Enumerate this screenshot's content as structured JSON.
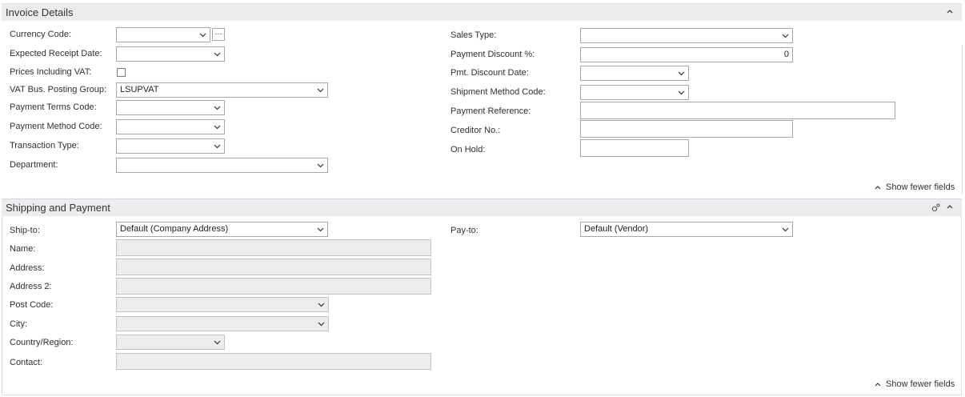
{
  "invoice": {
    "title": "Invoice Details",
    "show_fewer": "Show fewer fields",
    "left": {
      "currency_code": {
        "label": "Currency Code:",
        "value": ""
      },
      "expected_receipt_date": {
        "label": "Expected Receipt Date:",
        "value": ""
      },
      "prices_including_vat": {
        "label": "Prices Including VAT:",
        "checked": false
      },
      "vat_bus_posting_group": {
        "label": "VAT Bus. Posting Group:",
        "value": "LSUPVAT"
      },
      "payment_terms_code": {
        "label": "Payment Terms Code:",
        "value": ""
      },
      "payment_method_code": {
        "label": "Payment Method Code:",
        "value": ""
      },
      "transaction_type": {
        "label": "Transaction Type:",
        "value": ""
      },
      "department": {
        "label": "Department:",
        "value": ""
      }
    },
    "right": {
      "sales_type": {
        "label": "Sales Type:",
        "value": ""
      },
      "payment_discount_pct": {
        "label": "Payment Discount %:",
        "value": "0"
      },
      "pmt_discount_date": {
        "label": "Pmt. Discount Date:",
        "value": ""
      },
      "shipment_method_code": {
        "label": "Shipment Method Code:",
        "value": ""
      },
      "payment_reference": {
        "label": "Payment Reference:",
        "value": ""
      },
      "creditor_no": {
        "label": "Creditor No.:",
        "value": ""
      },
      "on_hold": {
        "label": "On Hold:",
        "value": ""
      }
    }
  },
  "shipping": {
    "title": "Shipping and Payment",
    "show_fewer": "Show fewer fields",
    "left": {
      "ship_to": {
        "label": "Ship-to:",
        "value": "Default (Company Address)"
      },
      "name": {
        "label": "Name:",
        "value": ""
      },
      "address": {
        "label": "Address:",
        "value": ""
      },
      "address_2": {
        "label": "Address 2:",
        "value": ""
      },
      "post_code": {
        "label": "Post Code:",
        "value": ""
      },
      "city": {
        "label": "City:",
        "value": ""
      },
      "country_region": {
        "label": "Country/Region:",
        "value": ""
      },
      "contact": {
        "label": "Contact:",
        "value": ""
      }
    },
    "right": {
      "pay_to": {
        "label": "Pay-to:",
        "value": "Default (Vendor)"
      }
    }
  },
  "icons": {
    "dropdown": "chevron-down-icon",
    "collapse": "chevron-up-icon",
    "settings": "gear-icon",
    "lookup": "ellipsis-icon"
  },
  "colors": {
    "header_bg": "#ececec",
    "field_border": "#a7a7a7",
    "disabled_bg": "#ededed"
  }
}
